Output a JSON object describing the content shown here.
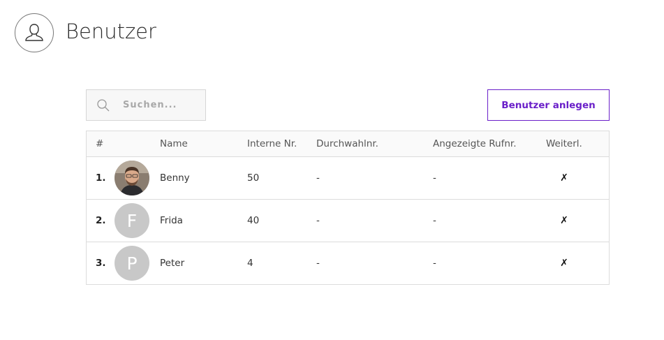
{
  "header": {
    "title": "Benutzer",
    "icon": "user-icon"
  },
  "search": {
    "placeholder": "Suchen...",
    "icon": "search-icon"
  },
  "toolbar": {
    "add_label": "Benutzer anlegen",
    "accent": "#6a1fc9"
  },
  "table": {
    "columns": [
      "#",
      "Name",
      "Interne Nr.",
      "Durchwahlnr.",
      "Angezeigte Rufnr.",
      "Weiterl."
    ],
    "rows": [
      {
        "num": "1.",
        "avatar": "photo",
        "initial": "",
        "name": "Benny",
        "intern": "50",
        "durch": "-",
        "angez": "-",
        "weiter": "✗"
      },
      {
        "num": "2.",
        "avatar": "initial",
        "initial": "F",
        "name": "Frida",
        "intern": "40",
        "durch": "-",
        "angez": "-",
        "weiter": "✗"
      },
      {
        "num": "3.",
        "avatar": "initial",
        "initial": "P",
        "name": "Peter",
        "intern": "4",
        "durch": "-",
        "angez": "-",
        "weiter": "✗"
      }
    ]
  }
}
